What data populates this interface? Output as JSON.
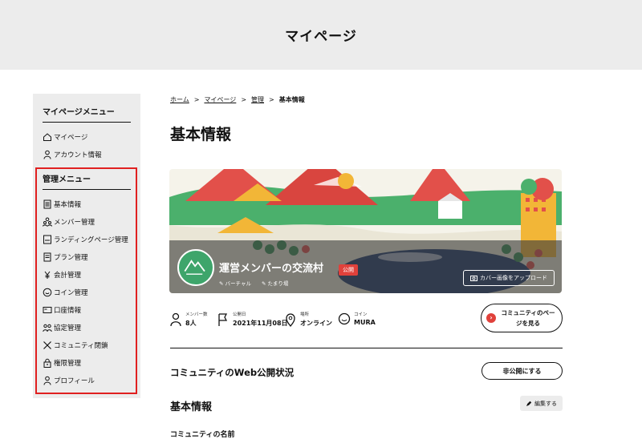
{
  "header": {
    "title": "マイページ"
  },
  "sidebar": {
    "mypage_title": "マイページメニュー",
    "mypage_items": [
      {
        "label": "マイページ",
        "icon": "home-icon"
      },
      {
        "label": "アカウント情報",
        "icon": "person-icon"
      }
    ],
    "admin_title": "管理メニュー",
    "admin_items": [
      {
        "label": "基本情報",
        "icon": "document-icon"
      },
      {
        "label": "メンバー管理",
        "icon": "members-icon"
      },
      {
        "label": "ランディングページ管理",
        "icon": "page-icon"
      },
      {
        "label": "プラン管理",
        "icon": "list-icon"
      },
      {
        "label": "会計管理",
        "icon": "yen-icon"
      },
      {
        "label": "コイン管理",
        "icon": "coin-icon"
      },
      {
        "label": "口座情報",
        "icon": "card-icon"
      },
      {
        "label": "協定管理",
        "icon": "agreement-icon"
      },
      {
        "label": "コミュニティ閉鎖",
        "icon": "close-icon"
      },
      {
        "label": "権限管理",
        "icon": "lock-icon"
      },
      {
        "label": "プロフィール",
        "icon": "person-icon"
      }
    ]
  },
  "breadcrumb": {
    "home": "ホーム",
    "mypage": "マイページ",
    "manage": "管理",
    "current": "基本情報",
    "sep": ">"
  },
  "page_title": "基本情報",
  "banner": {
    "community_name": "運営メンバーの交流村",
    "status_badge": "公開",
    "tag1": "バーチャル",
    "tag2": "たまり場",
    "upload_button": "カバー画像をアップロード"
  },
  "stats": {
    "members_label": "メンバー数",
    "members_value": "8人",
    "published_label": "公開日",
    "published_value": "2021年11月08日",
    "place_label": "場所",
    "place_value": "オンライン",
    "coin_label": "コイン",
    "coin_value": "MURA"
  },
  "view_button": {
    "line1": "コミュニティのペー",
    "line2": "ジを見る"
  },
  "web_status": {
    "label": "コミュニティのWeb公開状況",
    "button": "非公開にする"
  },
  "basic_info": {
    "label": "基本情報",
    "edit_button": "編集する",
    "next_label": "コミュニティの名前"
  },
  "colors": {
    "accent_red": "#e0413b",
    "highlight_border": "#e02020",
    "sidebar_bg": "#ececec"
  }
}
